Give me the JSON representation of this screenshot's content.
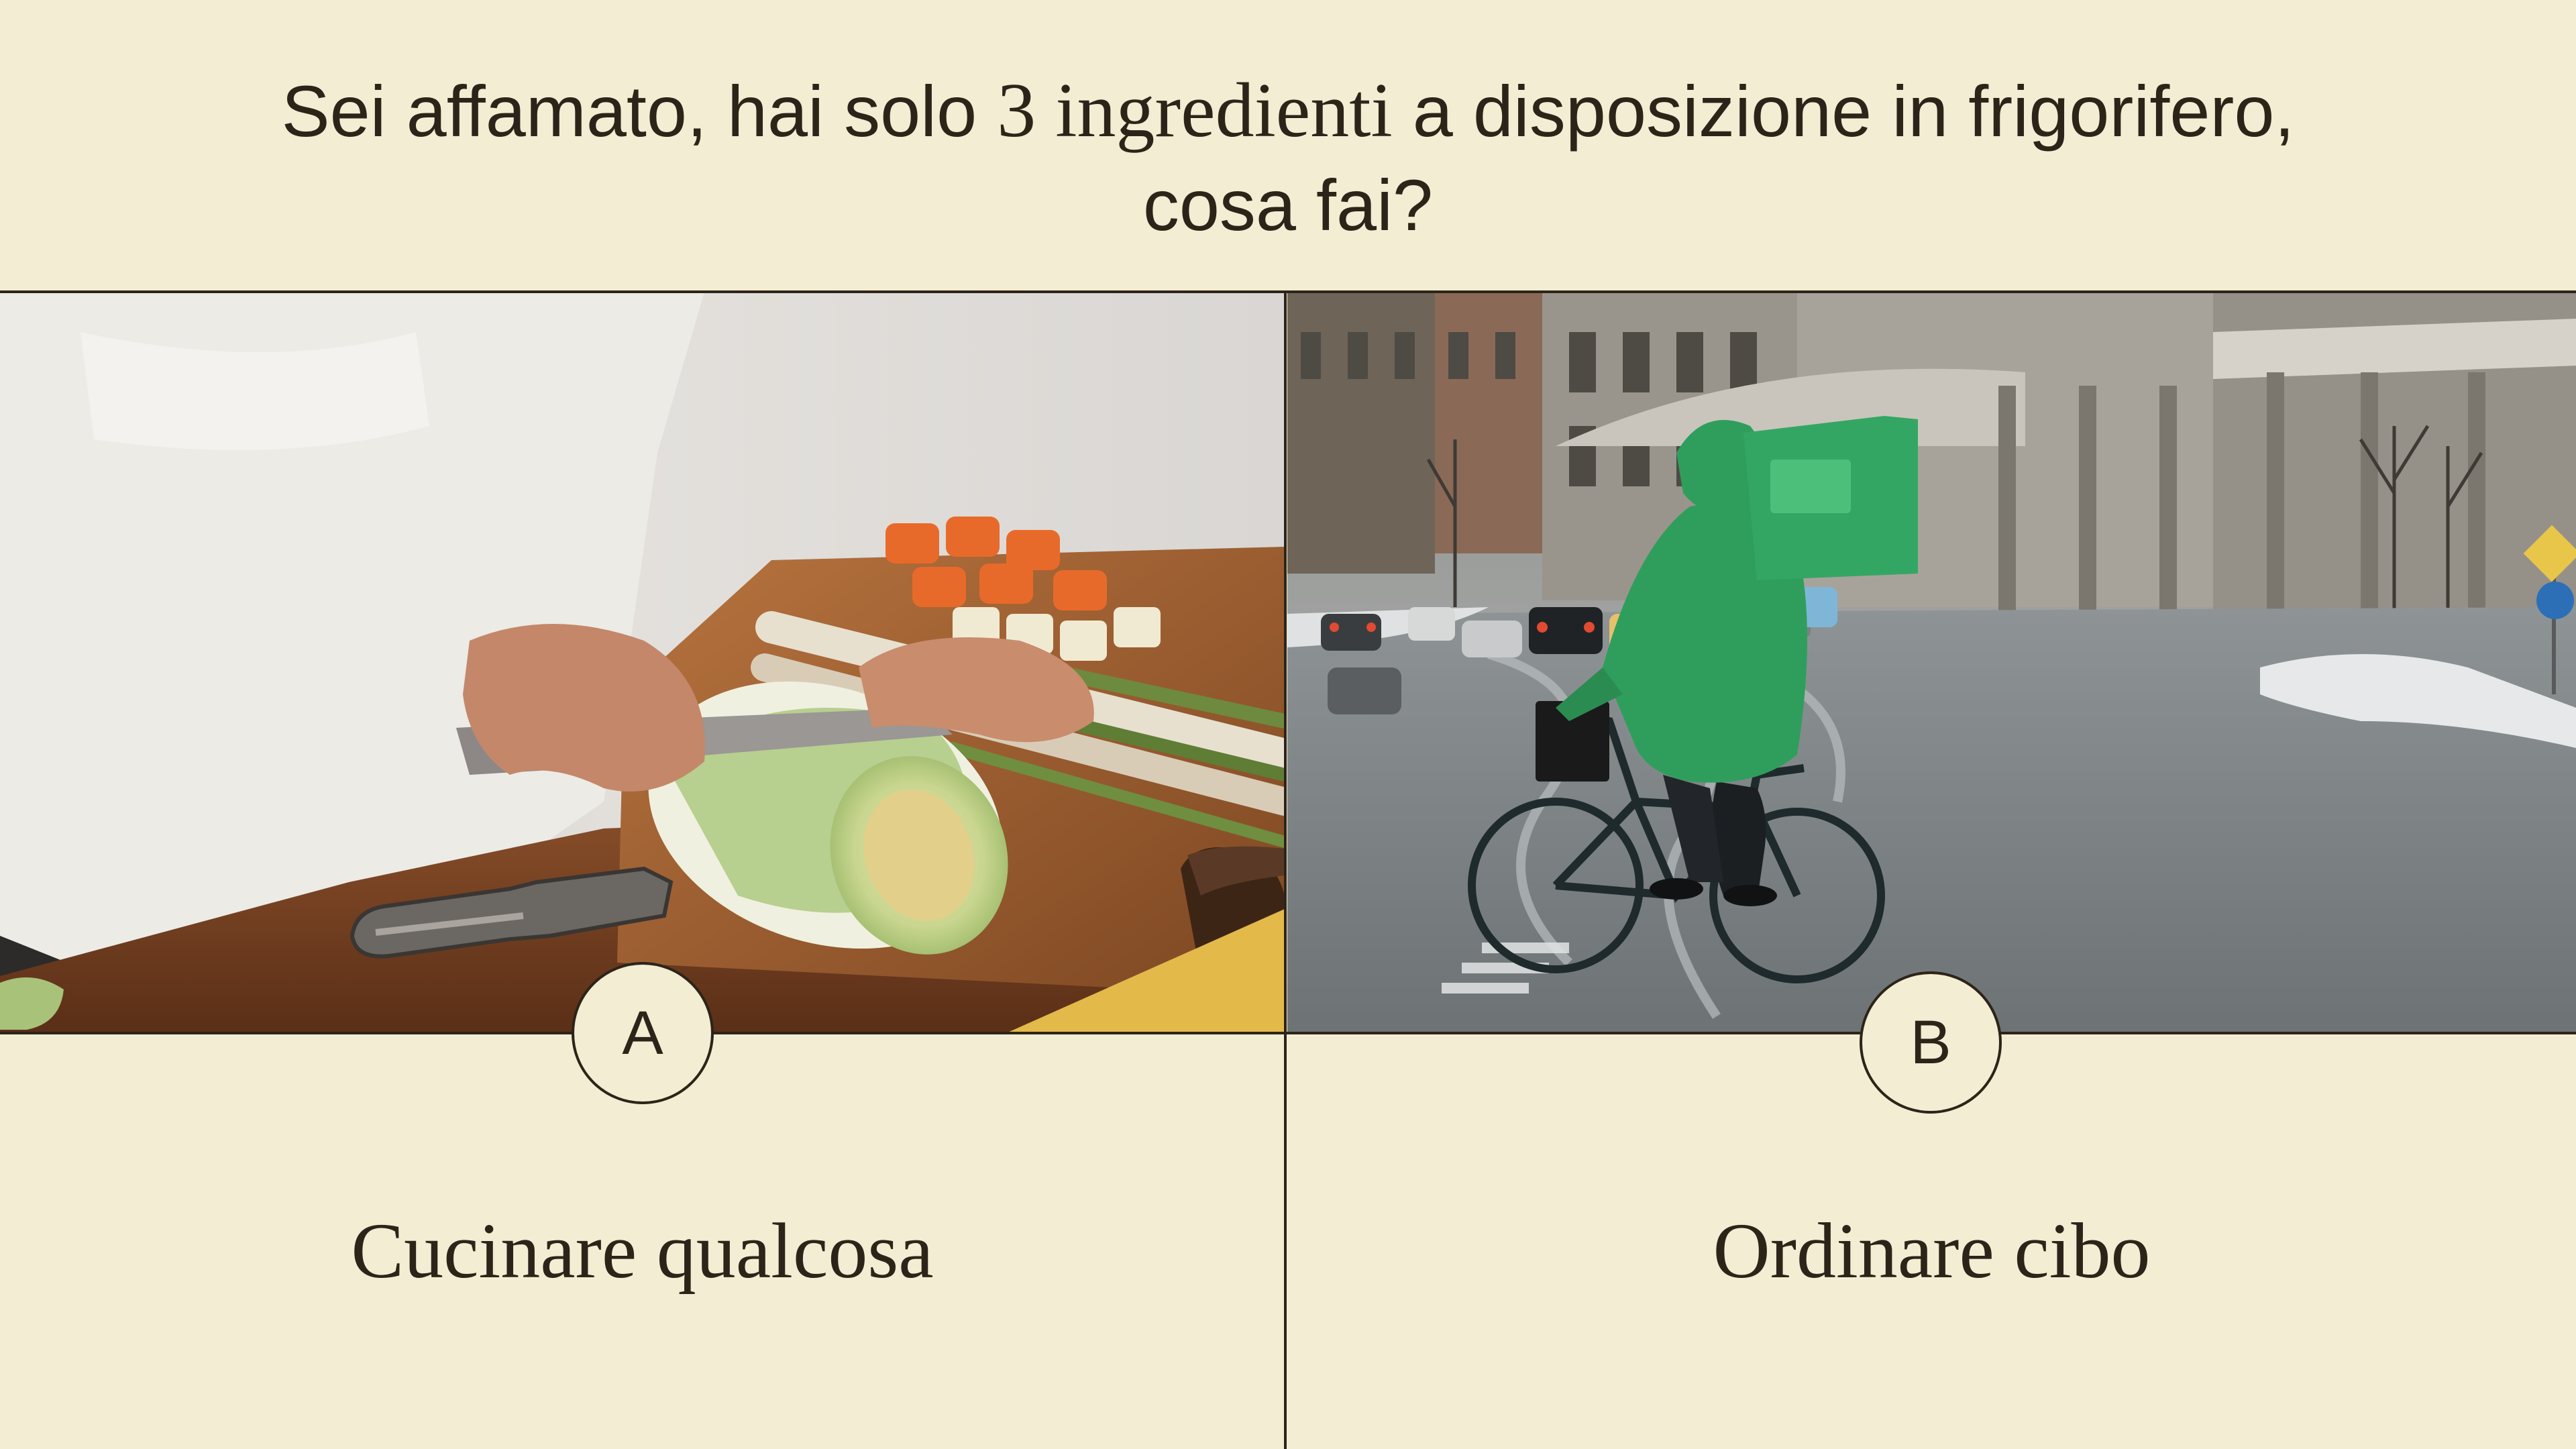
{
  "question": {
    "part1": "Sei affamato, hai solo",
    "part2": "3 ingredienti",
    "part3": "a disposizione in frigorifero,",
    "part4": "cosa fai?"
  },
  "options": [
    {
      "letter": "A",
      "label": "Cucinare qualcosa",
      "image": "person-cutting-vegetables-photo"
    },
    {
      "letter": "B",
      "label": "Ordinare cibo",
      "image": "delivery-rider-bicycle-snowy-street-photo"
    }
  ],
  "colors": {
    "background": "#f2edd3",
    "text": "#2d2419",
    "rider_jacket": "#2f9e5c"
  }
}
